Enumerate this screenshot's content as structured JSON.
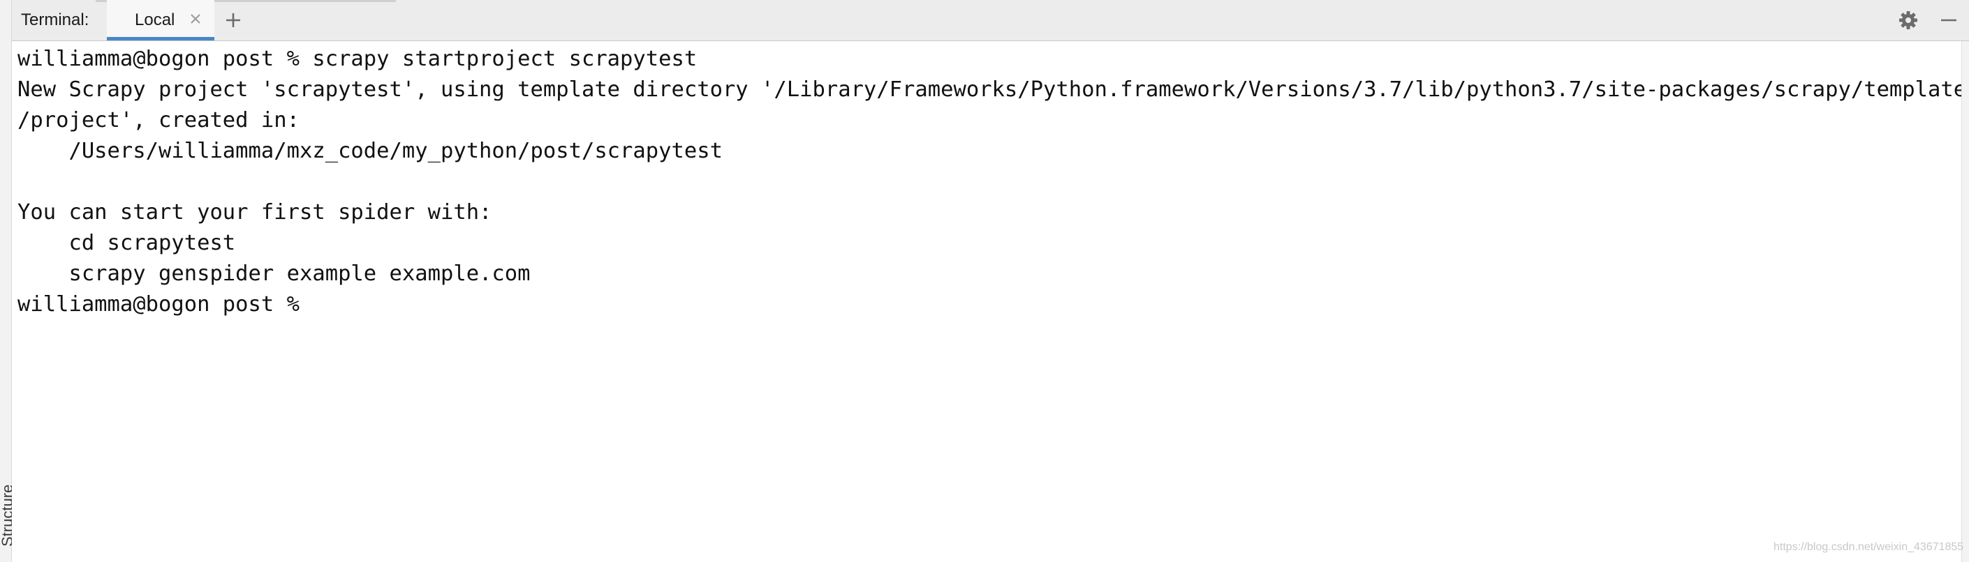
{
  "panel": {
    "title": "Terminal:",
    "side_tool_label": "Structure"
  },
  "tabs": [
    {
      "label": "Local",
      "active": true,
      "closable": true
    }
  ],
  "icons": {
    "close_tab": "close-icon",
    "new_tab": "plus-icon",
    "settings": "gear-icon",
    "hide": "minimize-icon"
  },
  "colors": {
    "active_tab_underline": "#4a86c8",
    "header_background": "#ececec",
    "terminal_text": "#111111"
  },
  "terminal": {
    "lines": [
      "williamma@bogon post % scrapy startproject scrapytest",
      "New Scrapy project 'scrapytest', using template directory '/Library/Frameworks/Python.framework/Versions/3.7/lib/python3.7/site-packages/scrapy/templates",
      "/project', created in:",
      "    /Users/williamma/mxz_code/my_python/post/scrapytest",
      "",
      "You can start your first spider with:",
      "    cd scrapytest",
      "    scrapy genspider example example.com",
      "williamma@bogon post % "
    ]
  },
  "watermark": "https://blog.csdn.net/weixin_43671855"
}
